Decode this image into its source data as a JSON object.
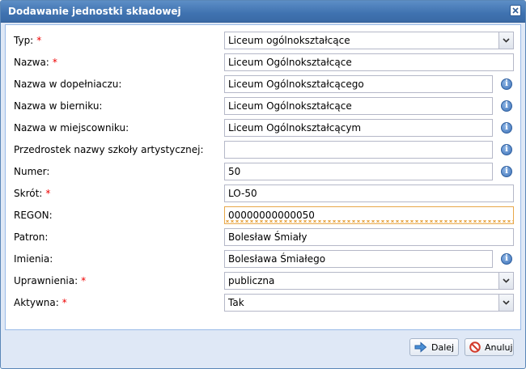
{
  "dialog": {
    "title": "Dodawanie jednostki składowej",
    "close_icon": "close-icon"
  },
  "form": {
    "required_marker": "*",
    "fields": [
      {
        "label": "Typ:",
        "required": true,
        "value": "Liceum ogólnokształcące",
        "kind": "select"
      },
      {
        "label": "Nazwa:",
        "required": true,
        "value": "Liceum Ogólnokształcące",
        "kind": "text"
      },
      {
        "label": "Nazwa w dopełniaczu:",
        "required": false,
        "value": "Liceum Ogólnokształcącego",
        "kind": "text",
        "info": true
      },
      {
        "label": "Nazwa w bierniku:",
        "required": false,
        "value": "Liceum Ogólnokształcące",
        "kind": "text",
        "info": true
      },
      {
        "label": "Nazwa w miejscowniku:",
        "required": false,
        "value": "Liceum Ogólnokształcącym",
        "kind": "text",
        "info": true
      },
      {
        "label": "Przedrostek nazwy szkoły artystycznej:",
        "required": false,
        "value": "",
        "kind": "text",
        "info": true
      },
      {
        "label": "Numer:",
        "required": false,
        "value": "50",
        "kind": "text",
        "info": true
      },
      {
        "label": "Skrót:",
        "required": true,
        "value": "LO-50",
        "kind": "text"
      },
      {
        "label": "REGON:",
        "required": false,
        "value": "00000000000050",
        "kind": "text",
        "focused": true
      },
      {
        "label": "Patron:",
        "required": false,
        "value": "Bolesław Śmiały",
        "kind": "text"
      },
      {
        "label": "Imienia:",
        "required": false,
        "value": "Bolesława Śmiałego",
        "kind": "text",
        "info": true
      },
      {
        "label": "Uprawnienia:",
        "required": true,
        "value": "publiczna",
        "kind": "select"
      },
      {
        "label": "Aktywna:",
        "required": true,
        "value": "Tak",
        "kind": "select"
      }
    ]
  },
  "footer": {
    "next_label": "Dalej",
    "cancel_label": "Anuluj"
  },
  "colors": {
    "titlebar": "#3f72b0",
    "required": "#ee0000",
    "focus_border": "#e8a84a"
  }
}
